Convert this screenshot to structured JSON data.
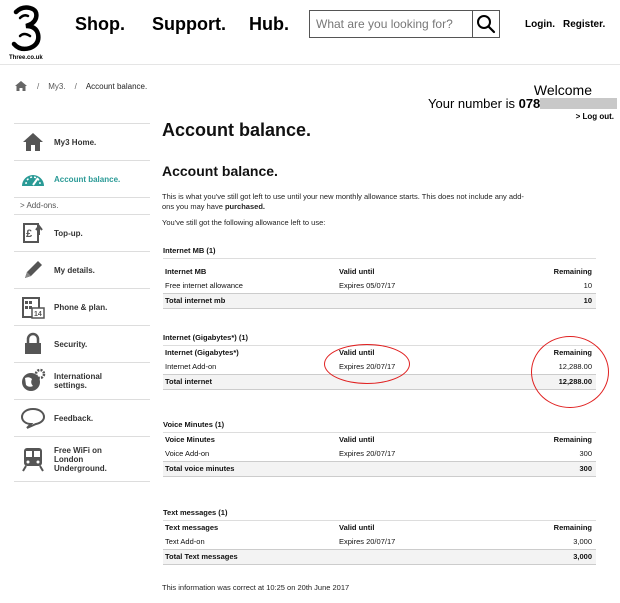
{
  "header": {
    "logo_text": "Three.co.uk",
    "nav": [
      "Shop.",
      "Support.",
      "Hub."
    ],
    "search_placeholder": "What are you looking for?",
    "login": "Login.",
    "register": "Register."
  },
  "breadcrumb": [
    "My3.",
    "Account balance."
  ],
  "account": {
    "welcome": "Welcome",
    "number_prefix": "Your number is",
    "number_visible": "078",
    "logout": "> Log out."
  },
  "sidebar": {
    "items": [
      {
        "label": "My3 Home.",
        "icon": "home-icon"
      },
      {
        "label": "Account balance.",
        "icon": "gauge-icon",
        "active": true
      },
      {
        "label": "> Add-ons.",
        "sub": true
      },
      {
        "label": "Top-up.",
        "icon": "pound-topup-icon"
      },
      {
        "label": "My details.",
        "icon": "pencil-icon"
      },
      {
        "label": "Phone & plan.",
        "icon": "calendar-icon"
      },
      {
        "label": "Security.",
        "icon": "lock-icon"
      },
      {
        "label": "International settings.",
        "icon": "globe-gear-icon"
      },
      {
        "label": "Feedback.",
        "icon": "speech-bubble-icon"
      },
      {
        "label": "Free WiFi on London Underground.",
        "icon": "train-icon"
      }
    ],
    "active_color": "#2a9a96"
  },
  "main": {
    "title": "Account balance.",
    "subtitle": "Account balance.",
    "intro_a": "This is what you've still got left to use until your new monthly allowance starts. This does not include any add-ons you may have",
    "intro_bold": "purchased.",
    "intro2": "You've still got the following allowance left to use:",
    "sections": [
      {
        "title": "Internet MB (1)",
        "head": [
          "Internet MB",
          "Valid until",
          "Remaining"
        ],
        "rows": [
          [
            "Free internet allowance",
            "Expires 05/07/17",
            "10"
          ]
        ],
        "total": [
          "Total internet mb",
          "10"
        ]
      },
      {
        "title": "Internet (Gigabytes*) (1)",
        "head": [
          "Internet (Gigabytes*)",
          "Valid until",
          "Remaining"
        ],
        "rows": [
          [
            "Internet Add-on",
            "Expires 20/07/17",
            "12,288.00"
          ]
        ],
        "total": [
          "Total internet",
          "12,288.00"
        ]
      },
      {
        "title": "Voice Minutes (1)",
        "head": [
          "Voice Minutes",
          "Valid until",
          "Remaining"
        ],
        "rows": [
          [
            "Voice Add-on",
            "Expires 20/07/17",
            "300"
          ]
        ],
        "total": [
          "Total voice minutes",
          "300"
        ]
      },
      {
        "title": "Text messages (1)",
        "head": [
          "Text messages",
          "Valid until",
          "Remaining"
        ],
        "rows": [
          [
            "Text Add-on",
            "Expires 20/07/17",
            "3,000"
          ]
        ],
        "total": [
          "Total Text messages",
          "3,000"
        ]
      }
    ],
    "correct_note": "This information was correct at 10:25 on 20th June 2017"
  },
  "annotation_color": "#e02020"
}
